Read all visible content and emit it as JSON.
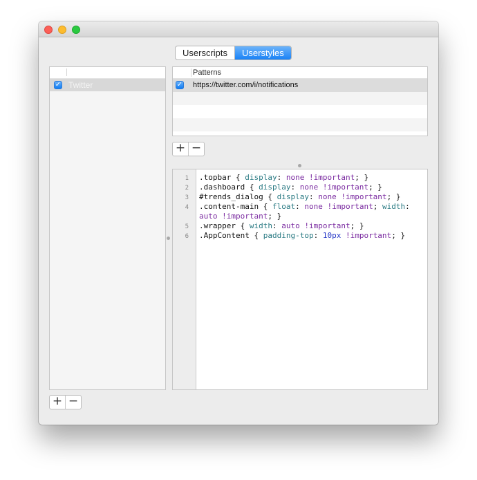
{
  "window": {
    "tabs": [
      {
        "label": "Userscripts",
        "active": false
      },
      {
        "label": "Userstyles",
        "active": true
      }
    ]
  },
  "sidebar": {
    "items": [
      {
        "label": "Twitter",
        "checked": true
      }
    ]
  },
  "patterns": {
    "header": "Patterns",
    "rows": [
      {
        "value": "https://twitter.com/i/notifications",
        "checked": true
      }
    ]
  },
  "buttons": {
    "add": "+",
    "remove": "−"
  },
  "editor": {
    "line_numbers": [
      "1",
      "2",
      "3",
      "4",
      "5",
      "6"
    ],
    "lines": [
      [
        {
          "t": "text",
          "v": ".topbar { "
        },
        {
          "t": "prop",
          "v": "display"
        },
        {
          "t": "text",
          "v": ": "
        },
        {
          "t": "val",
          "v": "none"
        },
        {
          "t": "text",
          "v": " "
        },
        {
          "t": "imp",
          "v": "!important"
        },
        {
          "t": "text",
          "v": "; }"
        }
      ],
      [
        {
          "t": "text",
          "v": ".dashboard { "
        },
        {
          "t": "prop",
          "v": "display"
        },
        {
          "t": "text",
          "v": ": "
        },
        {
          "t": "val",
          "v": "none"
        },
        {
          "t": "text",
          "v": " "
        },
        {
          "t": "imp",
          "v": "!important"
        },
        {
          "t": "text",
          "v": "; }"
        }
      ],
      [
        {
          "t": "text",
          "v": "#trends_dialog { "
        },
        {
          "t": "prop",
          "v": "display"
        },
        {
          "t": "text",
          "v": ": "
        },
        {
          "t": "val",
          "v": "none"
        },
        {
          "t": "text",
          "v": " "
        },
        {
          "t": "imp",
          "v": "!important"
        },
        {
          "t": "text",
          "v": "; }"
        }
      ],
      [
        {
          "t": "text",
          "v": ".content-main { "
        },
        {
          "t": "prop",
          "v": "float"
        },
        {
          "t": "text",
          "v": ": "
        },
        {
          "t": "val",
          "v": "none"
        },
        {
          "t": "text",
          "v": " "
        },
        {
          "t": "imp",
          "v": "!important"
        },
        {
          "t": "text",
          "v": "; "
        },
        {
          "t": "prop",
          "v": "width"
        },
        {
          "t": "text",
          "v": ":"
        }
      ],
      [
        {
          "t": "val",
          "v": "auto"
        },
        {
          "t": "text",
          "v": " "
        },
        {
          "t": "imp",
          "v": "!important"
        },
        {
          "t": "text",
          "v": "; }"
        }
      ],
      [
        {
          "t": "text",
          "v": ".wrapper { "
        },
        {
          "t": "prop",
          "v": "width"
        },
        {
          "t": "text",
          "v": ": "
        },
        {
          "t": "val",
          "v": "auto"
        },
        {
          "t": "text",
          "v": " "
        },
        {
          "t": "imp",
          "v": "!important"
        },
        {
          "t": "text",
          "v": "; }"
        }
      ],
      [
        {
          "t": "text",
          "v": ".AppContent { "
        },
        {
          "t": "prop",
          "v": "padding-top"
        },
        {
          "t": "text",
          "v": ": "
        },
        {
          "t": "num",
          "v": "10px"
        },
        {
          "t": "text",
          "v": " "
        },
        {
          "t": "imp",
          "v": "!important"
        },
        {
          "t": "text",
          "v": "; }"
        }
      ]
    ]
  }
}
